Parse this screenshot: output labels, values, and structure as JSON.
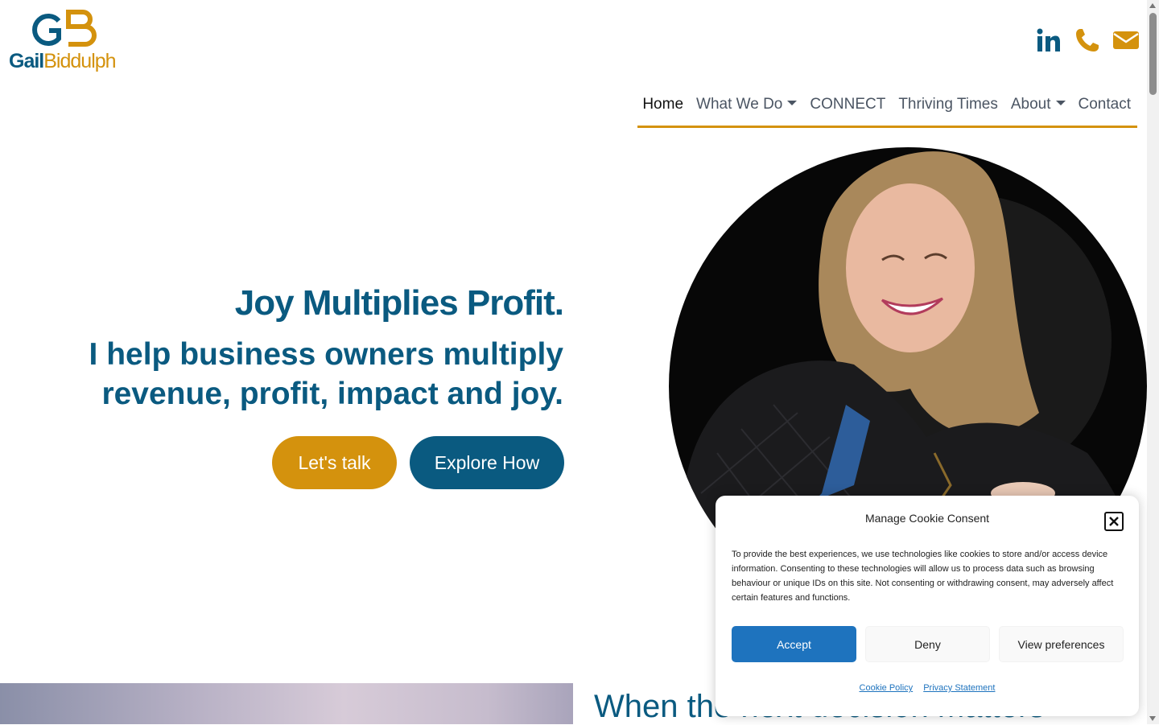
{
  "brand": {
    "logo_monogram": "GB",
    "logo_first": "Gail",
    "logo_last": "Biddulph",
    "colors": {
      "primary_blue": "#0a5a80",
      "accent_gold": "#d4920d",
      "accept_blue": "#1e73be"
    }
  },
  "social": [
    {
      "name": "linkedin",
      "icon": "linkedin-icon"
    },
    {
      "name": "phone",
      "icon": "phone-icon"
    },
    {
      "name": "email",
      "icon": "envelope-icon"
    }
  ],
  "nav": {
    "items": [
      {
        "label": "Home",
        "active": true,
        "dropdown": false
      },
      {
        "label": "What We Do",
        "active": false,
        "dropdown": true
      },
      {
        "label": "CONNECT",
        "active": false,
        "dropdown": false
      },
      {
        "label": "Thriving Times",
        "active": false,
        "dropdown": false
      },
      {
        "label": "About",
        "active": false,
        "dropdown": true
      },
      {
        "label": "Contact",
        "active": false,
        "dropdown": false
      }
    ]
  },
  "hero": {
    "title": "Joy Multiplies Profit.",
    "subtitle_line1": "I help business owners multiply",
    "subtitle_line2": "revenue, profit, impact and joy.",
    "cta_primary": "Let's talk",
    "cta_secondary": "Explore How"
  },
  "next_section": {
    "heading": "When the next decision matters"
  },
  "cookie": {
    "title": "Manage Cookie Consent",
    "body": "To provide the best experiences, we use technologies like cookies to store and/or access device information. Consenting to these technologies will allow us to process data such as browsing behaviour or unique IDs on this site. Not consenting or withdrawing consent, may adversely affect certain features and functions.",
    "accept": "Accept",
    "deny": "Deny",
    "preferences": "View preferences",
    "link_policy": "Cookie Policy",
    "link_privacy": "Privacy Statement"
  }
}
